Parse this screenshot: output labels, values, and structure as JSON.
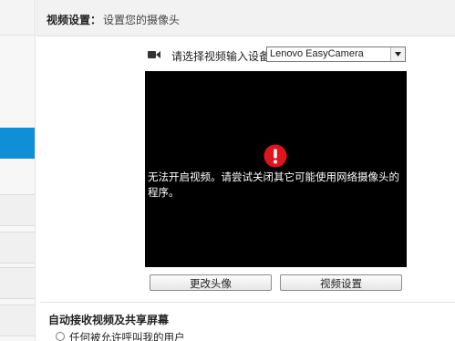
{
  "panel": {
    "title": "视频设置：",
    "subtitle": "设置您的摄像头"
  },
  "device": {
    "label": "请选择视频输入设备:",
    "selected": "Lenovo EasyCamera",
    "icon": "camera-icon"
  },
  "video": {
    "error_icon": "error-icon",
    "message": "无法开启视频。请尝试关闭其它可能使用网络摄像头的程序。",
    "background": "#000000"
  },
  "buttons": {
    "change_avatar": "更改头像",
    "video_settings": "视频设置"
  },
  "auto_accept": {
    "title": "自动接收视频及共享屏幕",
    "option_label": "任何被允许呼叫我的用户"
  },
  "colors": {
    "accent": "#0e8fd6",
    "error": "#e0141f"
  }
}
